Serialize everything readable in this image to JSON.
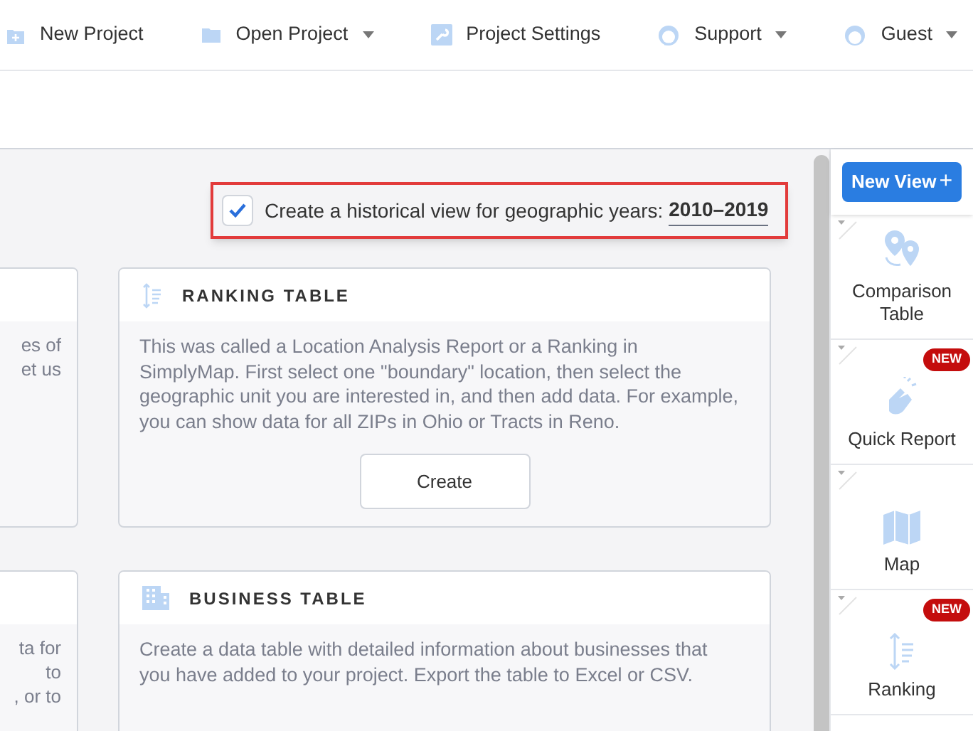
{
  "toolbar": [
    {
      "label": "New Project",
      "kind": "plain"
    },
    {
      "label": "Open Project",
      "kind": "dropdown"
    },
    {
      "label": "Project Settings",
      "kind": "plain"
    },
    {
      "label": "Support",
      "kind": "dropdown"
    },
    {
      "label": "Guest",
      "kind": "dropdown"
    }
  ],
  "historical_view": {
    "checked": true,
    "label": "Create a historical view for geographic years:",
    "years": "2010–2019"
  },
  "left_cards": [
    {
      "lines": [
        "es of",
        "et us"
      ]
    },
    {
      "lines": [
        "ta for",
        "to",
        ", or to"
      ]
    }
  ],
  "cards": [
    {
      "kind": "ranking",
      "title": "RANKING TABLE",
      "description": "This was called a Location Analysis Report or a Ranking in SimplyMap. First select one \"boundary\" location, then select the geographic unit you are interested in, and then add data. For example, you can show data for all ZIPs in Ohio or Tracts in Reno.",
      "button": "Create"
    },
    {
      "kind": "business",
      "title": "BUSINESS TABLE",
      "description": "Create a data table with detailed information about businesses that you have added to your project. Export the table to Excel or CSV."
    }
  ],
  "sidebar": {
    "new_view_button": "New View",
    "new_view_icon": "+",
    "items": [
      {
        "kind": "comparison",
        "label": "Comparison Table"
      },
      {
        "kind": "quick",
        "label": "Quick Report",
        "badge": "NEW"
      },
      {
        "kind": "map",
        "label": "Map"
      },
      {
        "kind": "ranking",
        "label": "Ranking",
        "badge": "NEW"
      }
    ]
  }
}
